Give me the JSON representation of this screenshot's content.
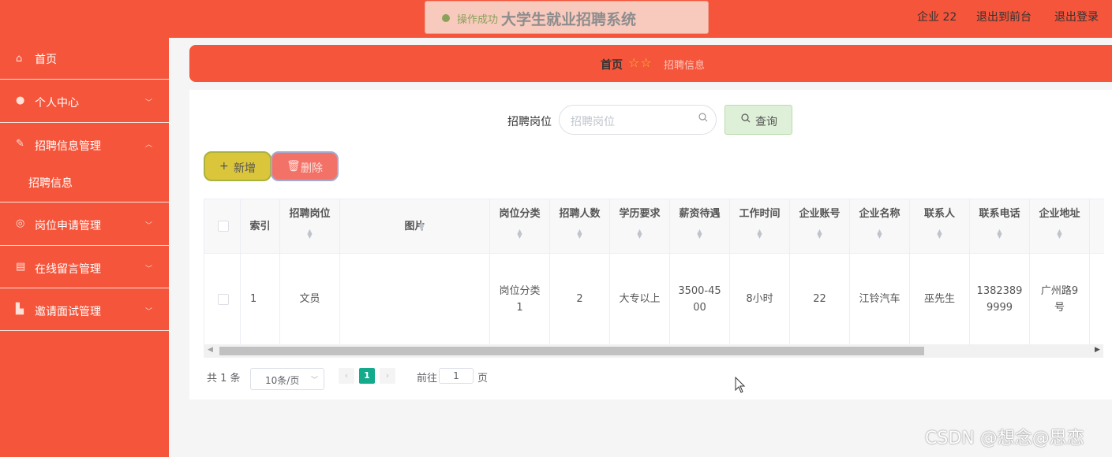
{
  "toast": {
    "status": "操作成功",
    "app_title": "大学生就业招聘系统"
  },
  "header": {
    "user": "企业 22",
    "back_front": "退出到前台",
    "logout": "退出登录"
  },
  "sidebar": {
    "items": [
      {
        "label": "首页",
        "icon": "home-icon"
      },
      {
        "label": "个人中心",
        "icon": "user-icon"
      },
      {
        "label": "招聘信息管理",
        "icon": "edit-icon",
        "sub": "招聘信息"
      },
      {
        "label": "岗位申请管理",
        "icon": "compass-icon"
      },
      {
        "label": "在线留言管理",
        "icon": "clipboard-icon"
      },
      {
        "label": "邀请面试管理",
        "icon": "thumb-icon"
      }
    ]
  },
  "breadcrumb": {
    "home": "首页",
    "current": "招聘信息"
  },
  "search": {
    "label": "招聘岗位",
    "placeholder": "招聘岗位",
    "query_label": "查询"
  },
  "actions": {
    "add": "新增",
    "delete": "删除"
  },
  "table": {
    "headers": {
      "index": "索引",
      "position": "招聘岗位",
      "image": "图片",
      "category": "岗位分类",
      "count": "招聘人数",
      "education": "学历要求",
      "salary": "薪资待遇",
      "worktime": "工作时间",
      "account": "企业账号",
      "company": "企业名称",
      "contact": "联系人",
      "phone": "联系电话",
      "address": "企业地址"
    },
    "rows": [
      {
        "index": "1",
        "position": "文员",
        "image": "",
        "category_l1": "岗位分类",
        "category_l2": "1",
        "count": "2",
        "education": "大专以上",
        "salary_l1": "3500-45",
        "salary_l2": "00",
        "worktime": "8小时",
        "account": "22",
        "company": "江铃汽车",
        "contact": "巫先生",
        "phone_l1": "1382389",
        "phone_l2": "9999",
        "address_l1": "广州路9",
        "address_l2": "号"
      }
    ]
  },
  "pagination": {
    "total": "共 1 条",
    "page_size": "10条/页",
    "current_page": "1",
    "goto": "前往",
    "goto_value": "1",
    "unit": "页"
  },
  "watermark": "CSDN @想念@思恋",
  "colors": {
    "primary": "#f5553b",
    "toast_bg": "#f8c9bd",
    "add_button": "#dbc53a",
    "delete_button": "#f37267",
    "page_active": "#13ab8c"
  }
}
